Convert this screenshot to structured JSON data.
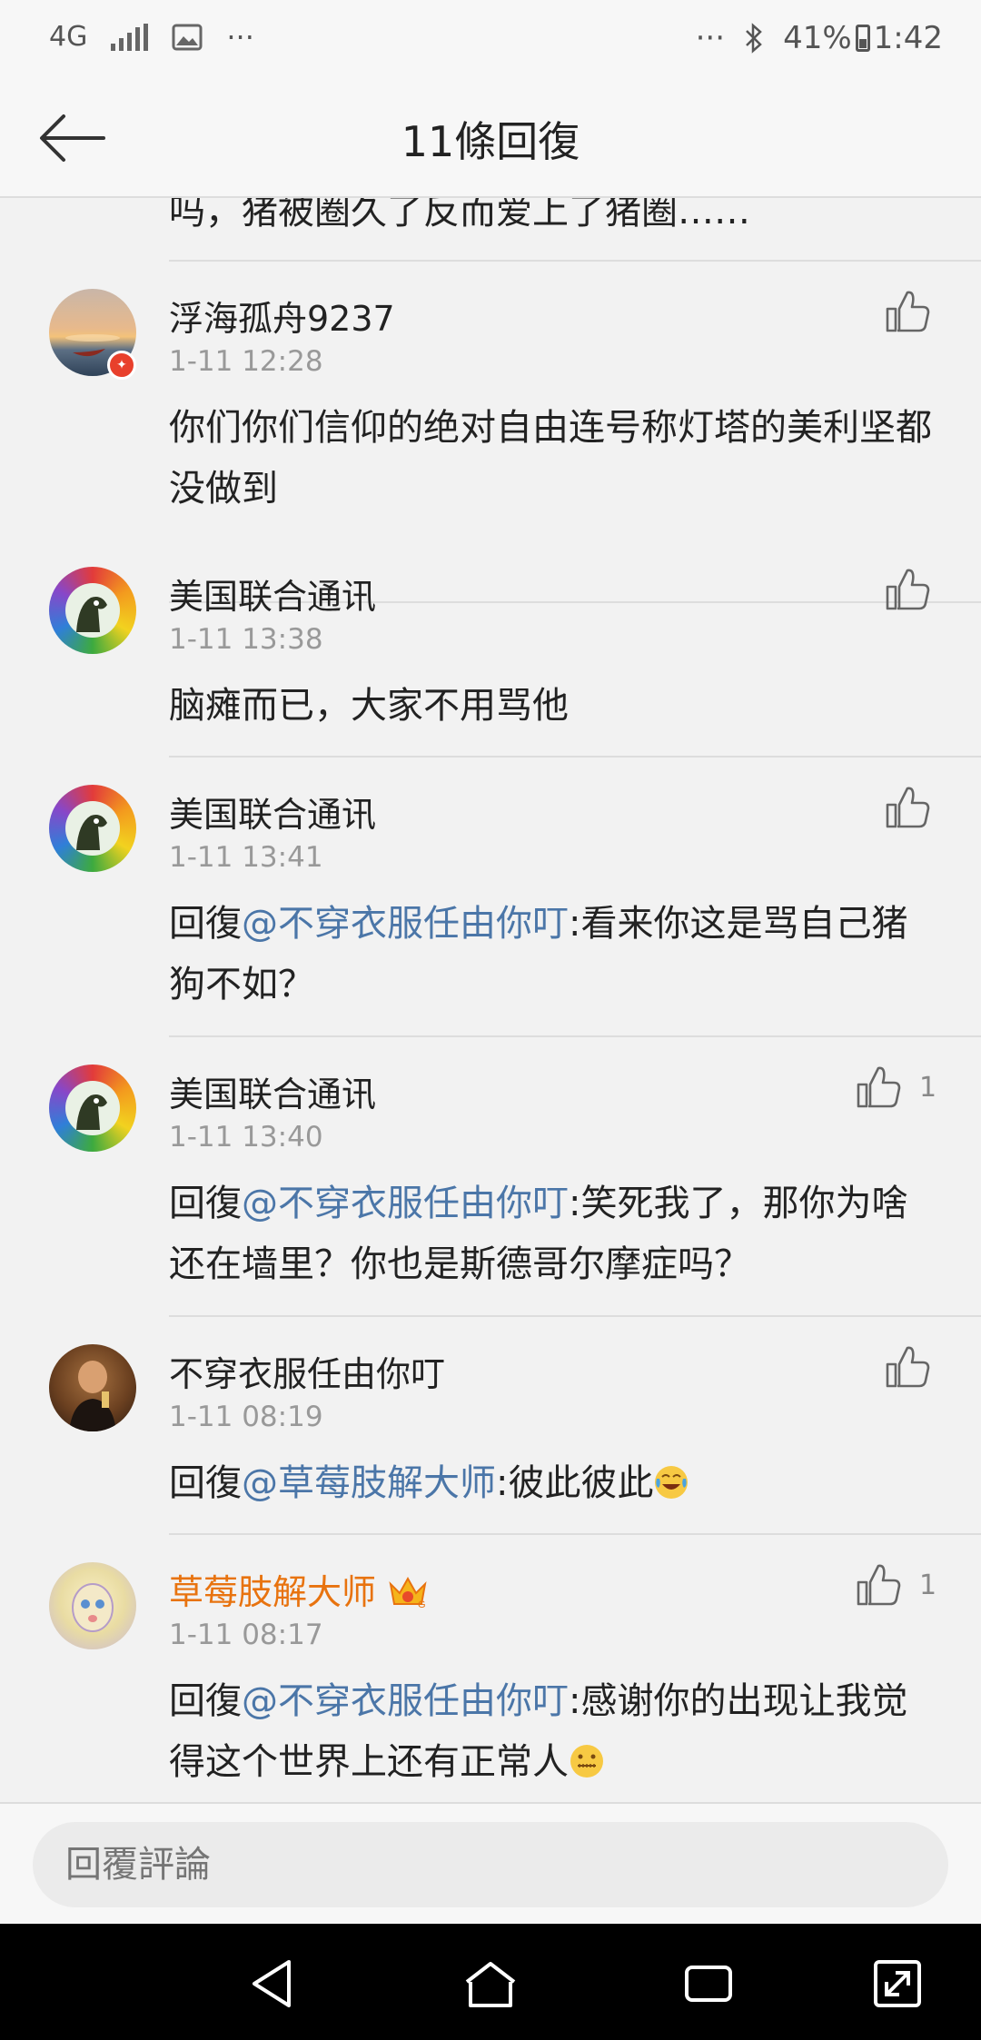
{
  "status_bar": {
    "network": "4G",
    "dots_left": "···",
    "dots_right": "···",
    "battery": "41%",
    "time": "1:42"
  },
  "header": {
    "title": "11條回復"
  },
  "previous_comment_tail": "吗，猪被圈久了反而爱上了猪圈……",
  "comments": [
    {
      "username": "浮海孤舟9237",
      "time": "1-11 12:28",
      "body": "你们你们信仰的绝对自由连号称灯塔的美利坚都没做到"
    },
    {
      "username": "美国联合通讯",
      "time": "1-11 13:38",
      "body": "脑瘫而已，大家不用骂他"
    },
    {
      "username": "美国联合通讯",
      "time": "1-11 13:41",
      "reply_prefix": "回復",
      "mention": "@不穿衣服任由你叮",
      "body": ":看来你这是骂自己猪狗不如？"
    },
    {
      "username": "美国联合通讯",
      "time": "1-11 13:40",
      "reply_prefix": "回復",
      "mention": "@不穿衣服任由你叮",
      "body": ":笑死我了，那你为啥还在墙里？你也是斯德哥尔摩症吗？",
      "likes": "1"
    },
    {
      "username": "不穿衣服任由你叮",
      "time": "1-11 08:19",
      "reply_prefix": "回復",
      "mention": "@草莓肢解大师",
      "body": ":彼此彼此",
      "emoji": "laugh-cry"
    },
    {
      "username": "草莓肢解大师",
      "username_color": "#e8730f",
      "time": "1-11 08:17",
      "reply_prefix": "回復",
      "mention": "@不穿衣服任由你叮",
      "body": ":感谢你的出现让我觉得这个世界上还有正常人",
      "emoji": "zipper-mouth",
      "likes": "1"
    }
  ],
  "reply_bar": {
    "placeholder": "回覆評論"
  },
  "colors": {
    "mention": "#4b76a8",
    "highlight_username": "#e8730f",
    "timestamp": "#999999",
    "background": "#f2f2f2"
  }
}
